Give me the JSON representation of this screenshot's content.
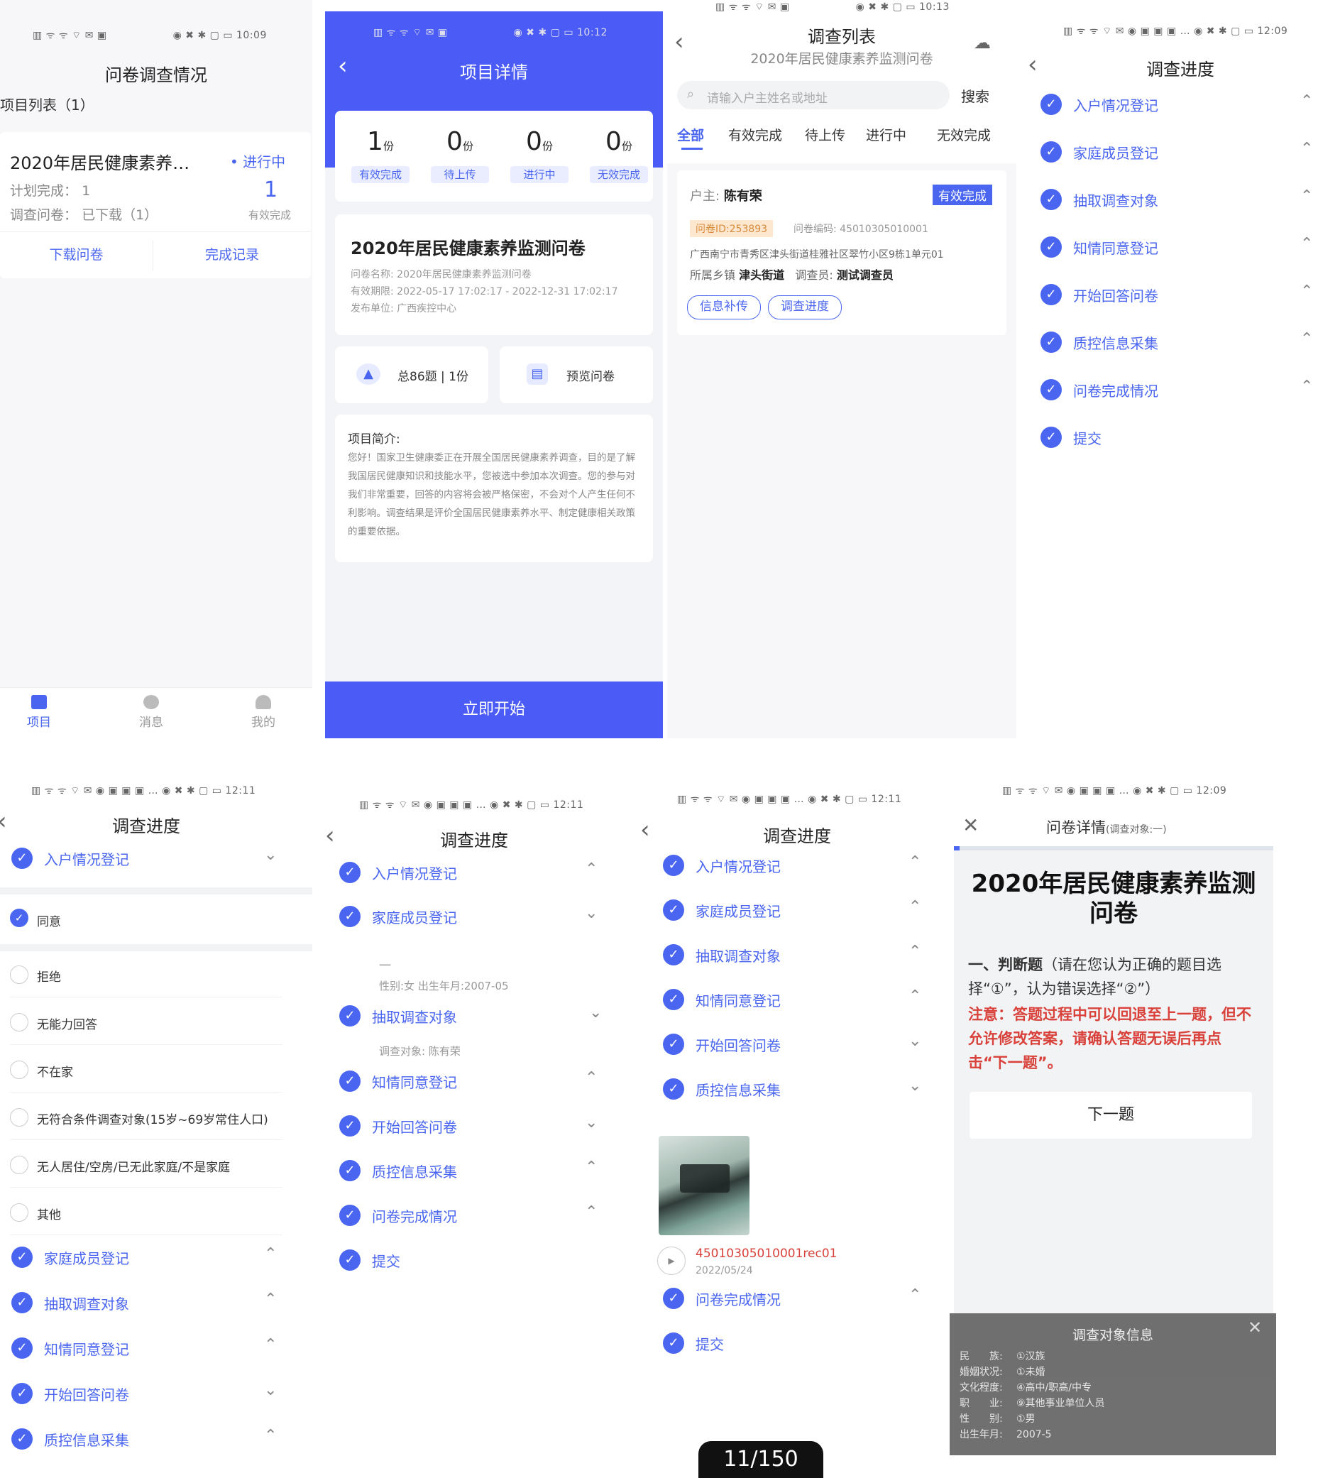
{
  "pager": "11/150",
  "s1": {
    "status_time": "10:09",
    "title": "问卷调查情况",
    "list_title": "项目列表（1）",
    "card_title": "2020年居民健康素养…",
    "card_status": "• 进行中",
    "plan_label": "计划完成：",
    "plan_value": "1",
    "survey_label": "调查问卷：",
    "survey_value": "已下载（1）",
    "done_num": "1",
    "done_label": "有效完成",
    "btn_download": "下载问卷",
    "btn_records": "完成记录",
    "nav": [
      {
        "label": "项目"
      },
      {
        "label": "消息"
      },
      {
        "label": "我的"
      }
    ]
  },
  "s2": {
    "status_time": "10:12",
    "title": "项目详情",
    "stats": [
      {
        "num": "1",
        "unit": "份",
        "label": "有效完成"
      },
      {
        "num": "0",
        "unit": "份",
        "label": "待上传"
      },
      {
        "num": "0",
        "unit": "份",
        "label": "进行中"
      },
      {
        "num": "0",
        "unit": "份",
        "label": "无效完成"
      }
    ],
    "project_title": "2020年居民健康素养监测问卷",
    "info1": "问卷名称: 2020年居民健康素养监测问卷",
    "info2": "有效期限: 2022-05-17 17:02:17 - 2022-12-31 17:02:17",
    "info3": "发布单位: 广西疾控中心",
    "total": "总86题 | 1份",
    "preview": "预览问卷",
    "intro_title": "项目简介:",
    "intro_text": "您好！国家卫生健康委正在开展全国居民健康素养调查，目的是了解我国居民健康知识和技能水平，您被选中参加本次调查。您的参与对我们非常重要，回答的内容将会被严格保密，不会对个人产生任何不利影响。调查结果是评价全国居民健康素养水平、制定健康相关政策的重要依据。",
    "start": "立即开始"
  },
  "s3": {
    "status_time": "10:13",
    "title": "调查列表",
    "subtitle": "2020年居民健康素养监测问卷",
    "search_placeholder": "请输入户主姓名或地址",
    "search_btn": "搜索",
    "tabs": [
      {
        "label": "全部"
      },
      {
        "label": "有效完成"
      },
      {
        "label": "待上传"
      },
      {
        "label": "进行中"
      },
      {
        "label": "无效完成"
      }
    ],
    "head_label": "户主:",
    "head_name": "陈有荣",
    "status": "有效完成",
    "qid": "问卷ID:253893",
    "qcode": "问卷编码: 45010305010001",
    "address": "广西南宁市青秀区津头街道桂雅社区翠竹小区9栋1单元01",
    "town_label": "所属乡镇",
    "town": "津头街道",
    "investigator_label": "调查员:",
    "investigator": "测试调查员",
    "btn1": "信息补传",
    "btn2": "调查进度"
  },
  "s4": {
    "status_time": "12:09",
    "title": "调查进度",
    "steps": [
      {
        "label": "入户情况登记"
      },
      {
        "label": "家庭成员登记"
      },
      {
        "label": "抽取调查对象"
      },
      {
        "label": "知情同意登记"
      },
      {
        "label": "开始回答问卷"
      },
      {
        "label": "质控信息采集"
      },
      {
        "label": "问卷完成情况"
      },
      {
        "label": "提交"
      }
    ]
  },
  "s5": {
    "status_time": "12:11",
    "title": "调查进度",
    "step_top": "入户情况登记",
    "agree": "同意",
    "options": [
      {
        "label": "拒绝"
      },
      {
        "label": "无能力回答"
      },
      {
        "label": "不在家"
      },
      {
        "label": "无符合条件调查对象(15岁~69岁常住人口)"
      },
      {
        "label": "无人居住/空房/已无此家庭/不是家庭"
      },
      {
        "label": "其他"
      }
    ],
    "steps_after": [
      {
        "label": "家庭成员登记"
      },
      {
        "label": "抽取调查对象"
      },
      {
        "label": "知情同意登记"
      },
      {
        "label": "开始回答问卷"
      },
      {
        "label": "质控信息采集"
      }
    ]
  },
  "s6": {
    "status_time": "12:11",
    "title": "调查进度",
    "steps": [
      {
        "label": "入户情况登记"
      },
      {
        "label": "家庭成员登记"
      }
    ],
    "member_name": "一",
    "member_info": "性别:女    出生年月:2007-05",
    "step3": "抽取调查对象",
    "target_info": "调查对象:  陈有荣",
    "steps_rest": [
      {
        "label": "知情同意登记"
      },
      {
        "label": "开始回答问卷"
      },
      {
        "label": "质控信息采集"
      },
      {
        "label": "问卷完成情况"
      },
      {
        "label": "提交"
      }
    ]
  },
  "s7": {
    "status_time": "12:11",
    "title": "调查进度",
    "steps": [
      {
        "label": "入户情况登记"
      },
      {
        "label": "家庭成员登记"
      },
      {
        "label": "抽取调查对象"
      },
      {
        "label": "知情同意登记"
      },
      {
        "label": "开始回答问卷"
      },
      {
        "label": "质控信息采集"
      }
    ],
    "rec_name": "45010305010001rec01",
    "rec_date": "2022/05/24",
    "steps_rest": [
      {
        "label": "问卷完成情况"
      },
      {
        "label": "提交"
      }
    ]
  },
  "s8": {
    "status_time": "12:09",
    "title": "问卷详情",
    "title_sub": "(调查对象:一)",
    "q_title": "2020年居民健康素养监测问卷",
    "section": "一、判断题",
    "section_text": "（请在您认为正确的题目选择“①”，认为错误选择“②”）",
    "note": "注意：答题过程中可以回退至上一题，但不允许修改答案，请确认答题无误后再点击“下一题”。",
    "next": "下一题",
    "panel_title": "调查对象信息",
    "info": [
      {
        "k": "民　　族:",
        "v": "①汉族"
      },
      {
        "k": "婚姻状况:",
        "v": "①未婚"
      },
      {
        "k": "文化程度:",
        "v": "④高中/职高/中专"
      },
      {
        "k": "职　　业:",
        "v": "⑨其他事业单位人员"
      },
      {
        "k": "性　　别:",
        "v": "①男"
      },
      {
        "k": "出生年月:",
        "v": "2007-5"
      }
    ]
  }
}
